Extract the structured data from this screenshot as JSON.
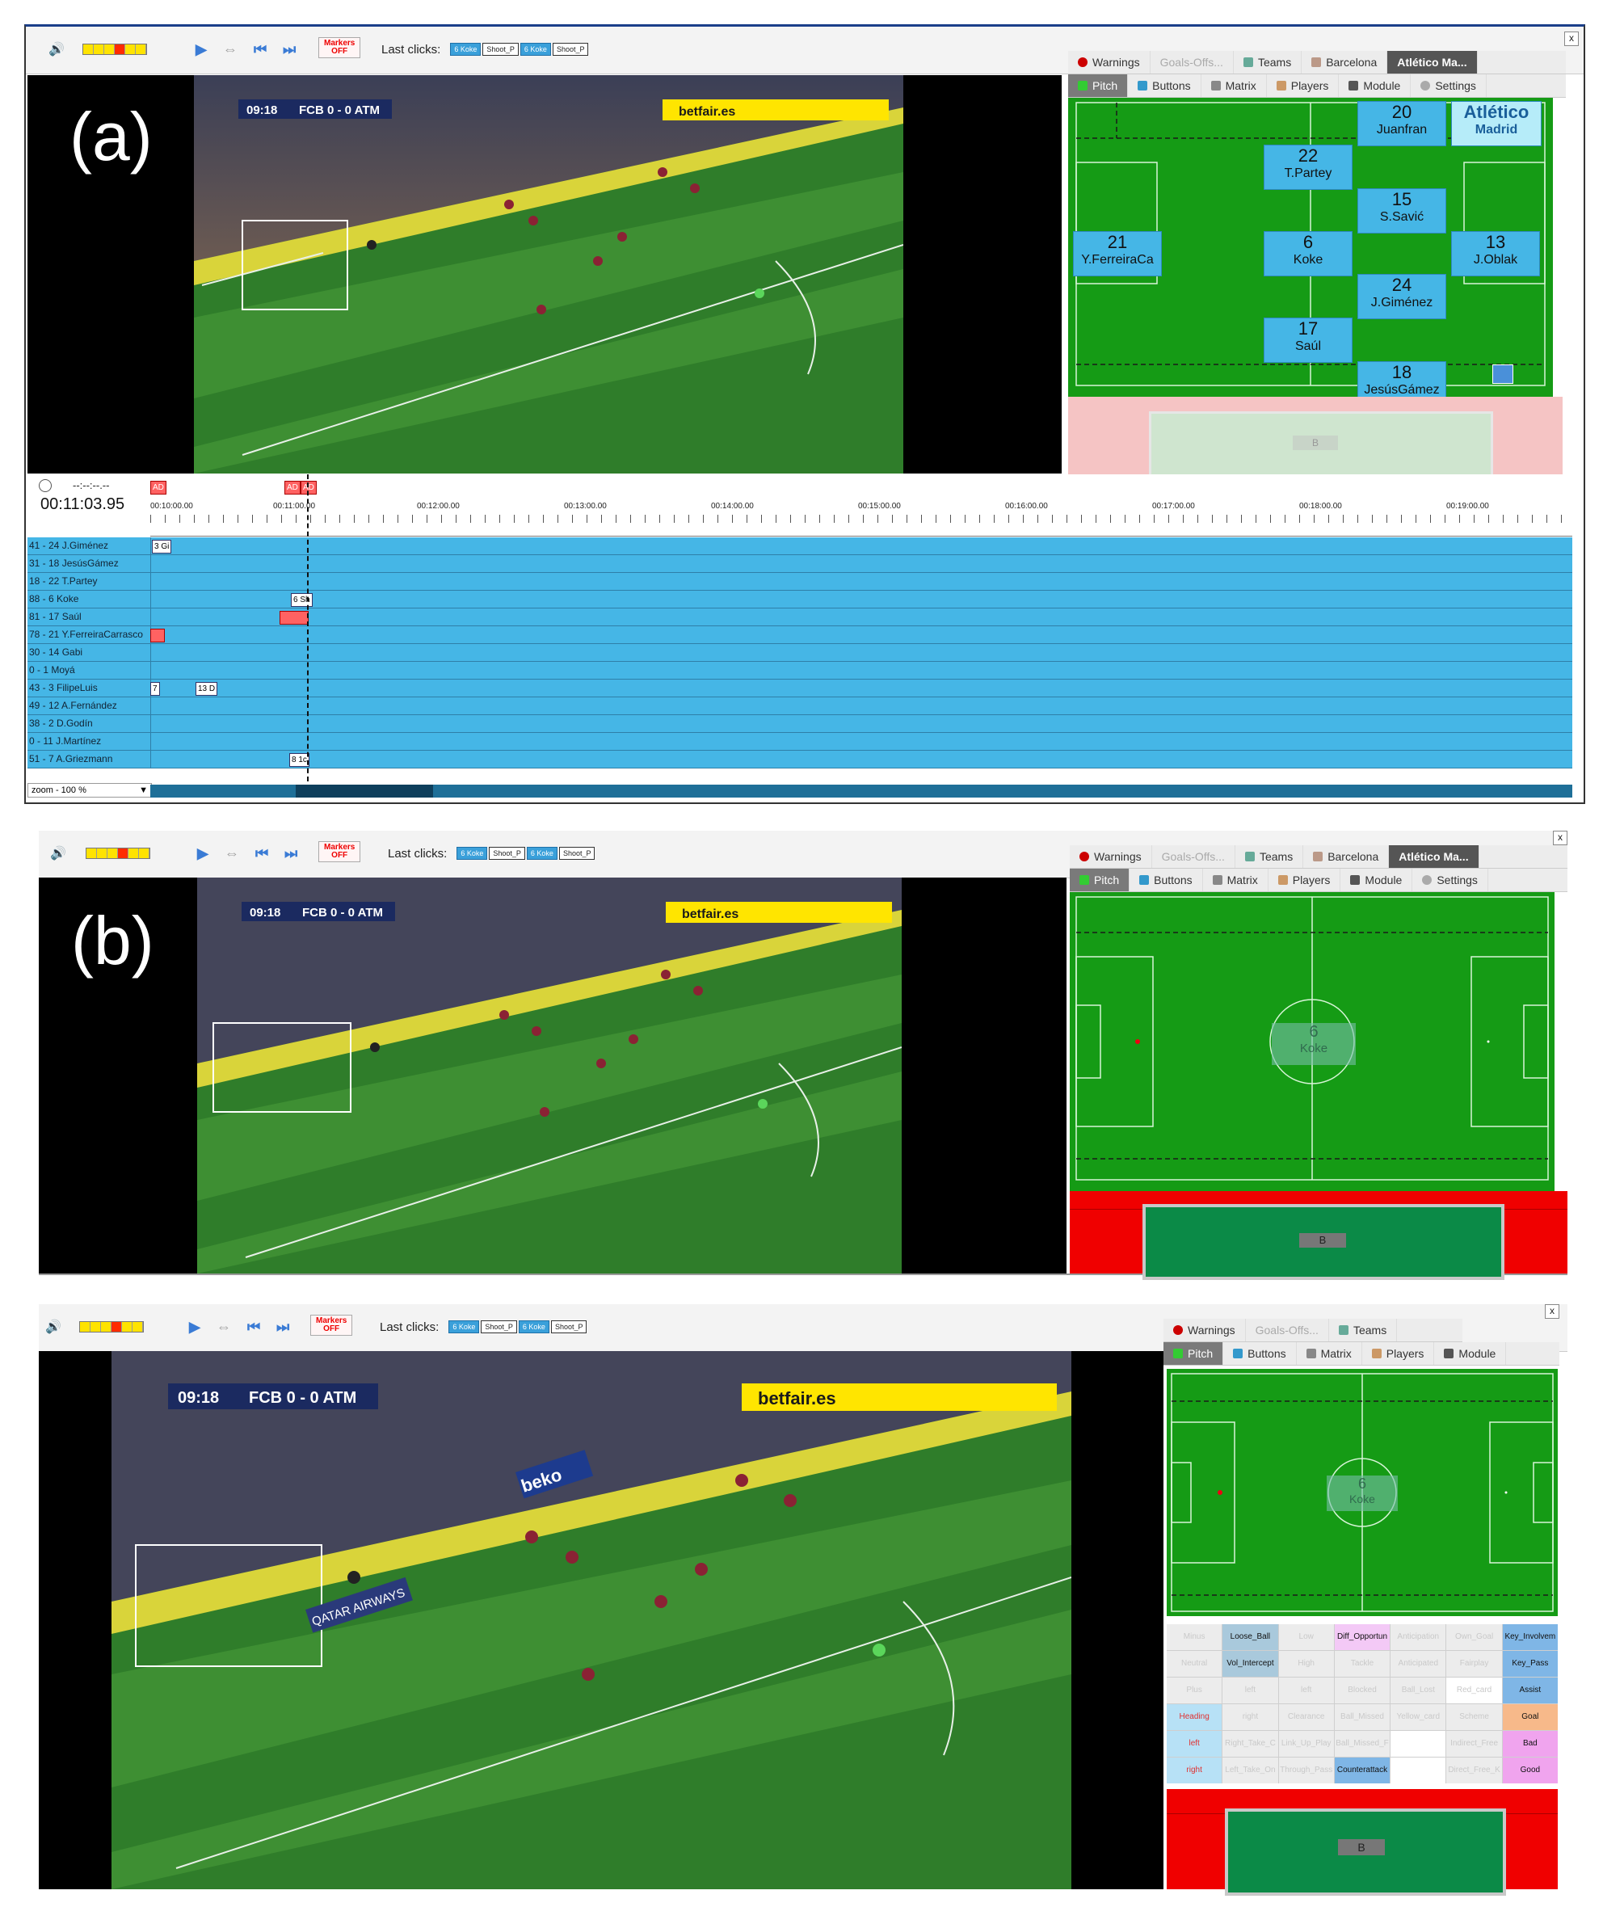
{
  "common": {
    "last_clicks_label": "Last clicks:",
    "markers_label_1": "Markers",
    "markers_label_2": "OFF",
    "chips": [
      "6 Koke",
      "Shoot_P",
      "6 Koke",
      "Shoot_P"
    ],
    "scoreboard_time": "09:18",
    "scoreboard_score": "FCB 0 - 0 ATM",
    "tabs_top": [
      "Warnings",
      "Goals-Offs...",
      "Teams",
      "Barcelona",
      "Atlético Ma..."
    ],
    "tabs_bottom": [
      "Pitch",
      "Buttons",
      "Matrix",
      "Players",
      "Module",
      "Settings"
    ],
    "close": "x",
    "ad_sign_1": "betfair.es",
    "ad_sign_2": "QATAR AIRWAYS",
    "ad_sign_3": "beko"
  },
  "panel_a": {
    "label": "(a)",
    "team_badge_1": "Atlético",
    "team_badge_2": "Madrid",
    "players": [
      {
        "num": "20",
        "name": "Juanfran"
      },
      {
        "num": "22",
        "name": "T.Partey"
      },
      {
        "num": "15",
        "name": "S.Savić"
      },
      {
        "num": "21",
        "name": "Y.FerreiraCa"
      },
      {
        "num": "6",
        "name": "Koke"
      },
      {
        "num": "13",
        "name": "J.Oblak"
      },
      {
        "num": "24",
        "name": "J.Giménez"
      },
      {
        "num": "17",
        "name": "Saúl"
      },
      {
        "num": "18",
        "name": "JesúsGámez"
      }
    ],
    "bench_label": "B",
    "timer_top": "--:--:--.--",
    "timer_main": "00:11:03.95",
    "ticks": [
      "00:10:00.00",
      "00:11:00.00",
      "00:12:00.00",
      "00:13:00.00",
      "00:14:00.00",
      "00:15:00.00",
      "00:16:00.00",
      "00:17:00.00",
      "00:18:00.00",
      "00:19:00.00"
    ],
    "ad_marker": "AD",
    "rows": [
      "41 - 24 J.Giménez",
      "31 - 18 JesúsGámez",
      "18 - 22 T.Partey",
      "88 - 6 Koke",
      "81 - 17 Saúl",
      "78 - 21 Y.FerreiraCarrasco",
      "30 - 14 Gabi",
      "0 - 1 Moyá",
      "43 - 3 FilipeLuis",
      "49 - 12 A.Fernández",
      "38 - 2 D.Godín",
      "0 - 11 J.Martínez",
      "51 - 7 A.Griezmann"
    ],
    "events": {
      "r0": "3 Gi",
      "r3": "6 Sh",
      "r8a": "7",
      "r8b": "13 D",
      "r12": "8 1c"
    },
    "zoom": "zoom - 100 %"
  },
  "panel_b": {
    "label": "(b)",
    "player_num": "6",
    "player_name": "Koke",
    "bench_label": "B"
  },
  "panel_c": {
    "player_num": "6",
    "player_name": "Koke",
    "bench_label": "B",
    "matrix": [
      [
        "Minus",
        "Loose_Ball",
        "Low",
        "Diff_Opportun",
        "Anticipation",
        "Own_Goal",
        "Key_Involvem"
      ],
      [
        "Neutral",
        "Vol_Intercept",
        "High",
        "Tackle",
        "Anticipated",
        "Fairplay",
        "Key_Pass"
      ],
      [
        "Plus",
        "left",
        "left",
        "Blocked",
        "Ball_Lost",
        "Red_card",
        "Assist"
      ],
      [
        "Heading",
        "right",
        "Clearance",
        "Ball_Missed",
        "Yellow_card",
        "Scheme",
        "Goal"
      ],
      [
        "left",
        "Right_Take_C",
        "Link_Up_Play",
        "Ball_Missed_F",
        "",
        "Indirect_Free",
        "Bad"
      ],
      [
        "right",
        "Left_Take_On",
        "Through_Pass",
        "Counterattack",
        "",
        "Direct_Free_K",
        "Good"
      ]
    ]
  }
}
